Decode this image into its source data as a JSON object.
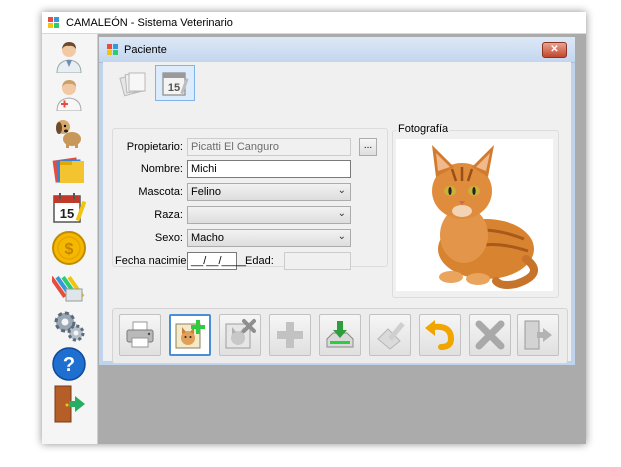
{
  "window": {
    "title": "CAMALEÓN - Sistema Veterinario"
  },
  "side_toolbar": {
    "items": [
      {
        "name": "doctor-icon"
      },
      {
        "name": "veterinarian-icon"
      },
      {
        "name": "dog-icon"
      },
      {
        "name": "folders-icon"
      },
      {
        "name": "calendar-icon",
        "day": "15"
      },
      {
        "name": "coin-icon"
      },
      {
        "name": "colored-pencils-icon"
      },
      {
        "name": "gears-icon"
      },
      {
        "name": "help-icon",
        "glyph": "?"
      },
      {
        "name": "exit-door-icon"
      }
    ]
  },
  "child": {
    "title": "Paciente",
    "close_glyph": "✕",
    "tabs": [
      {
        "name": "documents-icon"
      },
      {
        "name": "calendar-icon",
        "day": "15"
      }
    ]
  },
  "form": {
    "owner": {
      "label": "Propietario:",
      "value": "Picatti El Canguro",
      "button": "..."
    },
    "name": {
      "label": "Nombre:",
      "value": "Michi"
    },
    "pet": {
      "label": "Mascota:",
      "value": "Felino"
    },
    "breed": {
      "label": "Raza:",
      "value": ""
    },
    "sex": {
      "label": "Sexo:",
      "value": "Macho"
    },
    "birth": {
      "label": "Fecha nacimiento:",
      "value": "__/__/____"
    },
    "age": {
      "label": "Edad:",
      "value": ""
    }
  },
  "photo": {
    "legend": "Fotografía"
  },
  "toolbar": {
    "buttons": [
      {
        "name": "print-icon"
      },
      {
        "name": "add-pet-icon"
      },
      {
        "name": "remove-pet-icon"
      },
      {
        "name": "plus-icon"
      },
      {
        "name": "save-download-icon"
      },
      {
        "name": "edit-icon"
      },
      {
        "name": "undo-icon"
      },
      {
        "name": "delete-x-icon"
      },
      {
        "name": "exit-door-icon"
      }
    ]
  },
  "colors": {
    "accent": "#4a8fd6",
    "mdi_background": "#ababab",
    "child_titlebar": "#c4d6ee"
  }
}
